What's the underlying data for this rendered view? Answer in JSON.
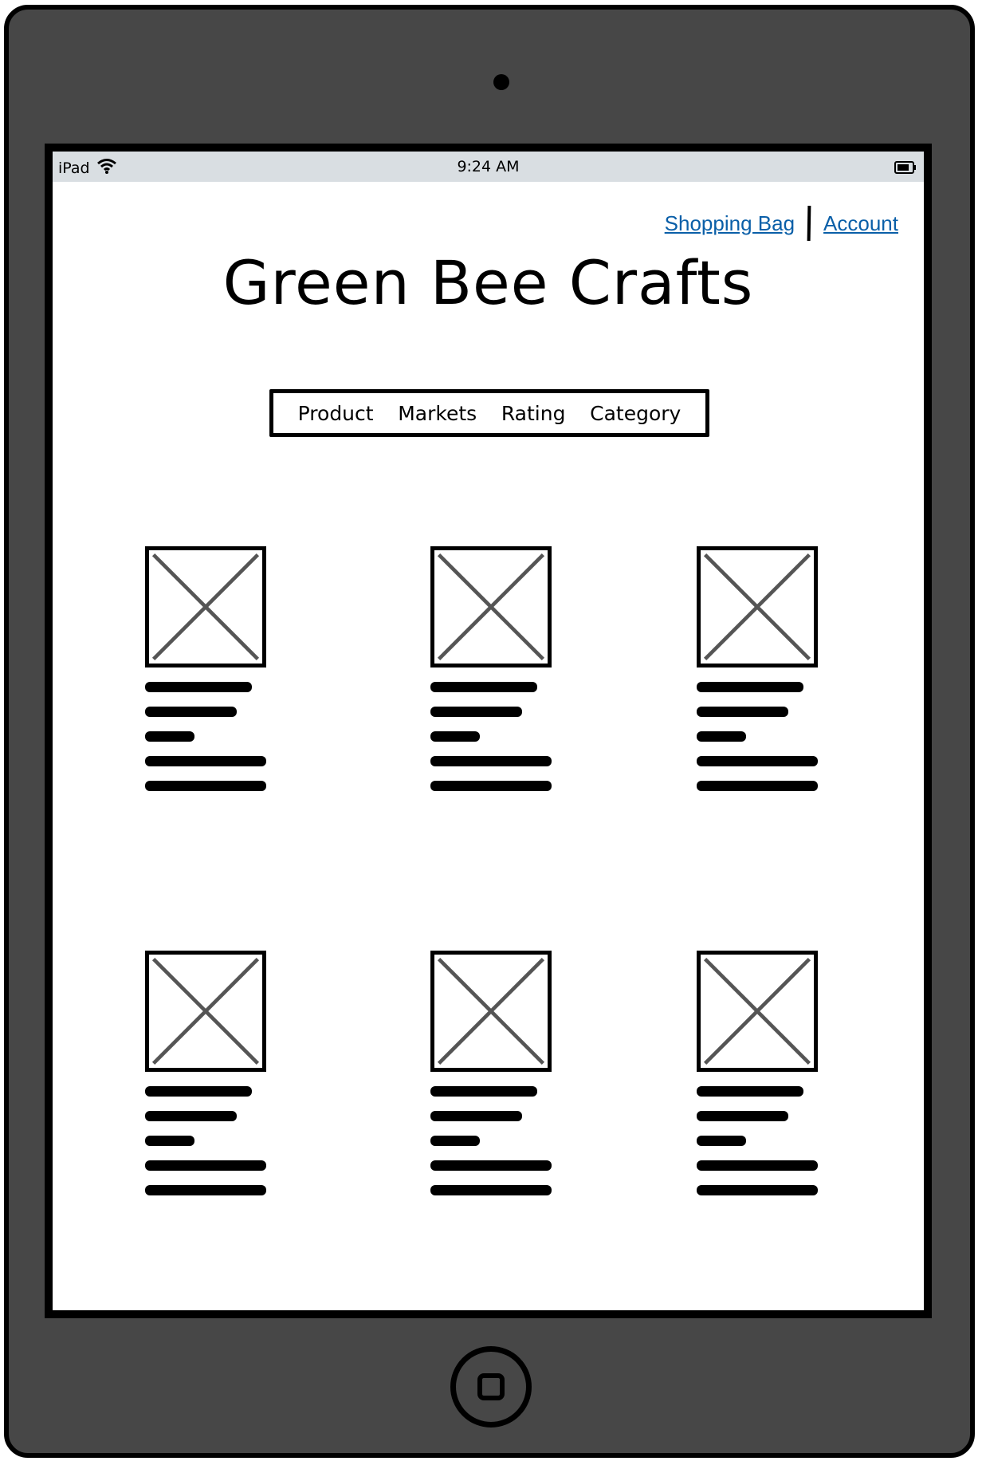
{
  "status_bar": {
    "device": "iPad",
    "time": "9:24 AM",
    "wifi_icon": "wifi-icon",
    "battery_icon": "battery-icon"
  },
  "header": {
    "links": {
      "shopping_bag": "Shopping Bag",
      "account": "Account"
    },
    "title": "Green Bee Crafts"
  },
  "nav": {
    "items": [
      "Product",
      "Markets",
      "Rating",
      "Category"
    ]
  },
  "products": {
    "count": 6,
    "image_placeholder_icon": "image-placeholder-icon"
  },
  "colors": {
    "link": "#0a5fa8",
    "device_frame": "#474747",
    "status_bar": "#d9dee2"
  }
}
